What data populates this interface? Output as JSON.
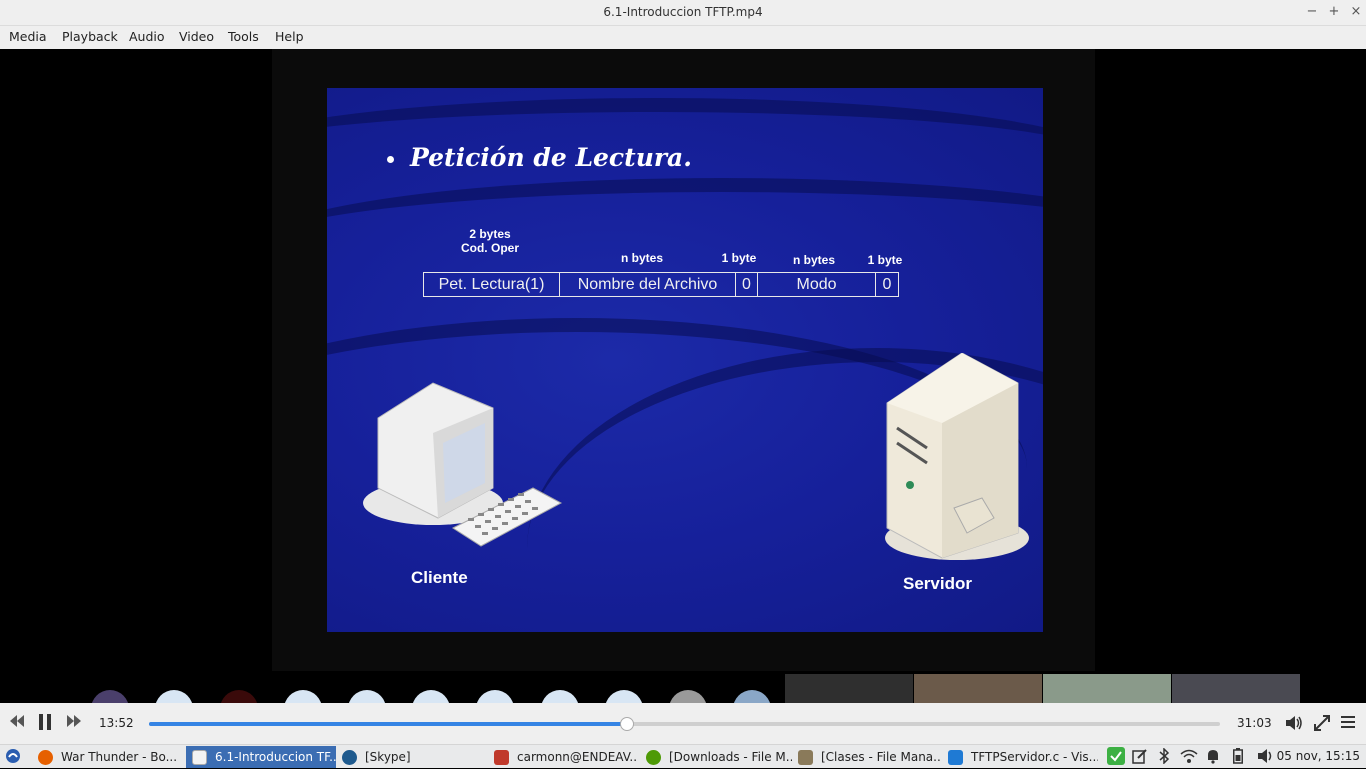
{
  "window": {
    "title": "6.1-Introduccion TFTP.mp4",
    "minimize": "−",
    "maximize": "+",
    "close": "×"
  },
  "menu": [
    "Media",
    "Playback",
    "Audio",
    "Video",
    "Tools",
    "Help"
  ],
  "slide": {
    "title": "Petición de Lectura.",
    "headers": {
      "opcode": [
        "2 bytes",
        "Cod. Oper"
      ],
      "filename": "n bytes",
      "zero1": "1 byte",
      "mode": "n bytes",
      "zero2": "1 byte"
    },
    "packet": [
      "Pet. Lectura(1)",
      "Nombre del Archivo",
      "0",
      "Modo",
      "0"
    ],
    "client_label": "Cliente",
    "server_label": "Servidor"
  },
  "controls": {
    "current_time": "13:52",
    "total_time": "31:03",
    "progress": 0.446,
    "rewind_icon": "rewind-icon",
    "pause_icon": "pause-icon",
    "forward_icon": "fast-forward-icon",
    "volume_icon": "volume-icon",
    "fullscreen_icon": "fullscreen-icon",
    "menu_icon": "hamburger-menu-icon"
  },
  "taskbar": {
    "tasks": [
      {
        "label": "War Thunder - Bo...",
        "icon": "firefox-icon",
        "color": "#e66000",
        "active": false
      },
      {
        "label": "6.1-Introduccion TF...",
        "icon": "video-player-icon",
        "color": "#2b2b2b",
        "active": true
      },
      {
        "label": "[Skype]",
        "icon": "skype-icon",
        "color": "#00aff0",
        "active": false
      },
      {
        "label": "carmonn@ENDEAV...",
        "icon": "terminal-icon",
        "color": "#c0392b",
        "active": false
      },
      {
        "label": "[Downloads - File M...",
        "icon": "download-icon",
        "color": "#4e9a06",
        "active": false
      },
      {
        "label": "[Clases - File Mana...",
        "icon": "folder-icon",
        "color": "#8a7a5a",
        "active": false
      },
      {
        "label": "TFTPServidor.c - Vis...",
        "icon": "vscode-icon",
        "color": "#1f7ad4",
        "active": false
      }
    ],
    "clock": "05 nov, 15:15"
  },
  "colors": {
    "slide_bg": "#16209a",
    "accent": "#3584e4",
    "active_task": "#3b6db3"
  }
}
